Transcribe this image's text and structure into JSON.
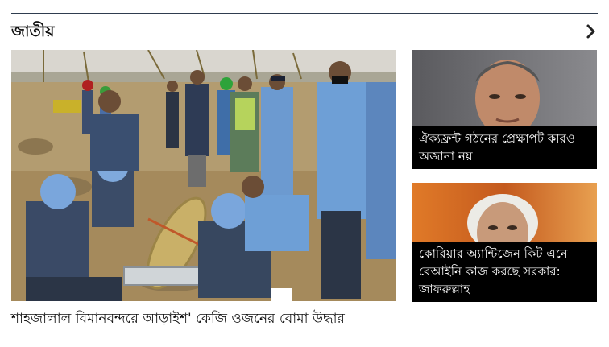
{
  "section": {
    "title": "জাতীয়",
    "more_icon": "chevron-right-icon"
  },
  "main_story": {
    "headline": "শাহজালাল বিমানবন্দরে আড়াইশ' কেজি ওজনের বোমা উদ্ধার",
    "image_alt": "Officers in blue uniforms and helmets around an unearthed bomb at a construction site"
  },
  "side_stories": [
    {
      "headline": "ঐক্যফ্রন্ট গঠনের প্রেক্ষাপট কারও অজানা নয়",
      "image_alt": "Portrait of a man with grey hair"
    },
    {
      "headline": "কোরিয়ার অ্যান্টিজেন কিট এনে বেআইনি কাজ করছে সরকার: জাফরুল্লাহ",
      "image_alt": "Portrait of an elderly man with white hair"
    }
  ],
  "colors": {
    "rule": "#2f3d4f",
    "caption_bg": "#000000",
    "caption_text": "#ffffff"
  }
}
